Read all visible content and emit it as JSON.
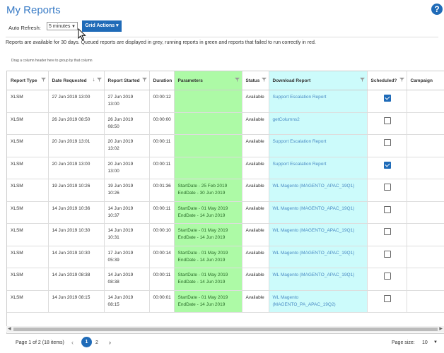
{
  "header": {
    "title": "My Reports",
    "help_icon": "question-circle-icon",
    "help_glyph": "?"
  },
  "toolbar": {
    "auto_refresh_label": "Auto Refresh:",
    "auto_refresh_value": "5 minutes",
    "grid_actions_label": "Grid Actions ▾"
  },
  "info_text": "Reports are available for 30 days. Queued reports are displayed in grey, running reports in green and reports that failed to run correctly in red.",
  "group_hint": "Drag a column header here to group by that column",
  "columns": [
    "Report Type",
    "Date Requested",
    "Report Started",
    "Duration",
    "Parameters",
    "Status",
    "Download Report",
    "Scheduled?",
    "Campaign"
  ],
  "rows": [
    {
      "type": "XLSM",
      "requested": "27 Jun 2019 13:00",
      "started": "27 Jun 2019 13:00",
      "duration": "00:00:12",
      "params": "",
      "status": "Available",
      "download": "Support Escalation Report",
      "scheduled": true,
      "campaign": ""
    },
    {
      "type": "XLSM",
      "requested": "26 Jun 2019 08:50",
      "started": "26 Jun 2019 08:50",
      "duration": "00:00:00",
      "params": "",
      "status": "Available",
      "download": "getColumns2",
      "scheduled": false,
      "campaign": ""
    },
    {
      "type": "XLSM",
      "requested": "20 Jun 2019 13:01",
      "started": "20 Jun 2019 13:02",
      "duration": "00:00:11",
      "params": "",
      "status": "Available",
      "download": "Support Escalation Report",
      "scheduled": false,
      "campaign": ""
    },
    {
      "type": "XLSM",
      "requested": "20 Jun 2019 13:00",
      "started": "20 Jun 2019 13:00",
      "duration": "00:00:11",
      "params": "",
      "status": "Available",
      "download": "Support Escalation Report",
      "scheduled": true,
      "campaign": ""
    },
    {
      "type": "XLSM",
      "requested": "19 Jun 2019 10:26",
      "started": "19 Jun 2019 10:26",
      "duration": "00:01:36",
      "params": "StartDate - 25 Feb 2019\nEndDate - 30 Jun 2019",
      "status": "Available",
      "download": "WL Magento (MAGENTO_APAC_19Q1)",
      "scheduled": false,
      "campaign": ""
    },
    {
      "type": "XLSM",
      "requested": "14 Jun 2019 10:36",
      "started": "14 Jun 2019 10:37",
      "duration": "00:00:11",
      "params": "StartDate - 01 May 2019\nEndDate - 14 Jun 2019",
      "status": "Available",
      "download": "WL Magento (MAGENTO_APAC_19Q1)",
      "scheduled": false,
      "campaign": ""
    },
    {
      "type": "XLSM",
      "requested": "14 Jun 2019 10:30",
      "started": "14 Jun 2019 10:31",
      "duration": "00:00:10",
      "params": "StartDate - 01 May 2019\nEndDate - 14 Jun 2019",
      "status": "Available",
      "download": "WL Magento (MAGENTO_APAC_19Q1)",
      "scheduled": false,
      "campaign": ""
    },
    {
      "type": "XLSM",
      "requested": "14 Jun 2019 10:30",
      "started": "17 Jun 2019 05:39",
      "duration": "00:00:14",
      "params": "StartDate - 01 May 2019\nEndDate - 14 Jun 2019",
      "status": "Available",
      "download": "WL Magento (MAGENTO_APAC_19Q1)",
      "scheduled": false,
      "campaign": ""
    },
    {
      "type": "XLSM",
      "requested": "14 Jun 2019 08:38",
      "started": "14 Jun 2019 08:38",
      "duration": "00:00:11",
      "params": "StartDate - 01 May 2019\nEndDate - 14 Jun 2019",
      "status": "Available",
      "download": "WL Magento (MAGENTO_APAC_19Q1)",
      "scheduled": false,
      "campaign": ""
    },
    {
      "type": "XLSM",
      "requested": "14 Jun 2019 08:15",
      "started": "14 Jun 2019 08:15",
      "duration": "00:00:01",
      "params": "StartDate - 01 May 2019\nEndDate - 14 Jun 2019",
      "status": "Available",
      "download": "WL Magento\n(MAGENTO_PA_APAC_19Q2)",
      "scheduled": false,
      "campaign": ""
    }
  ],
  "pager": {
    "info": "Page 1 of 2 (18 items)",
    "pages": [
      "1",
      "2"
    ],
    "current_page": "1",
    "prev_glyph": "‹",
    "next_glyph": "›",
    "page_size_label": "Page size:",
    "page_size_value": "10"
  },
  "colors": {
    "title": "#3a7cc6",
    "accent": "#1f6bb8",
    "params_bg": "#adfaa6",
    "download_bg": "#ccfbfb",
    "link": "#4a8bc4"
  }
}
